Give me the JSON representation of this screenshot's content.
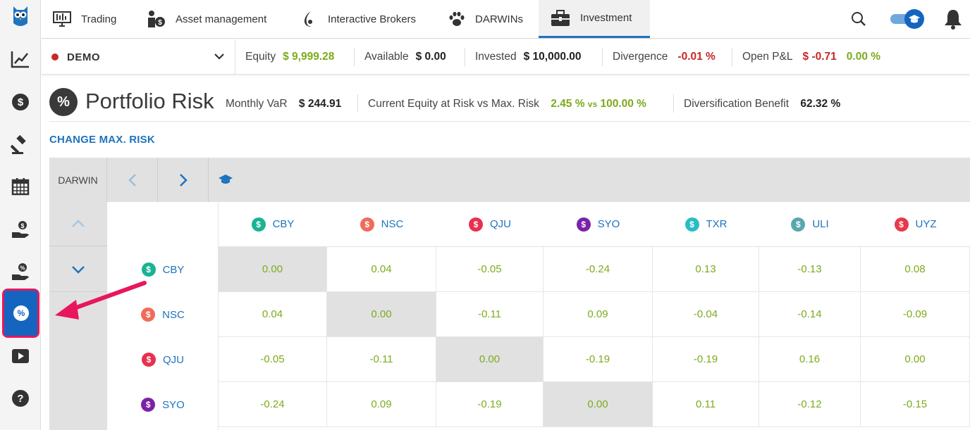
{
  "nav": {
    "items": [
      {
        "label": "Trading",
        "icon": "chart-monitor-icon"
      },
      {
        "label": "Asset management",
        "icon": "investor-icon"
      },
      {
        "label": "Interactive Brokers",
        "icon": "ib-logo-icon"
      },
      {
        "label": "DARWINs",
        "icon": "paw-icon"
      },
      {
        "label": "Investment",
        "icon": "briefcase-icon"
      }
    ],
    "active": "Investment"
  },
  "account": {
    "mode": "DEMO",
    "equity_label": "Equity",
    "equity": "$ 9,999.28",
    "available_label": "Available",
    "available": "$ 0.00",
    "invested_label": "Invested",
    "invested": "$ 10,000.00",
    "divergence_label": "Divergence",
    "divergence": "-0.01 %",
    "openpl_label": "Open P&L",
    "openpl": "$ -0.71",
    "openpl_pct": "0.00 %"
  },
  "risk": {
    "icon_glyph": "%",
    "title": "Portfolio Risk",
    "var_label": "Monthly VaR",
    "var": "$ 244.91",
    "equity_risk_label": "Current Equity at Risk vs Max. Risk",
    "equity_risk": "2.45 %",
    "vs": "vs",
    "max_risk": "100.00 %",
    "diversification_label": "Diversification Benefit",
    "diversification": "62.32 %",
    "change_link": "CHANGE MAX. RISK"
  },
  "table": {
    "corner_label": "DARWIN",
    "columns": [
      {
        "name": "CBY",
        "color": "#1ab394"
      },
      {
        "name": "NSC",
        "color": "#ef6c5b"
      },
      {
        "name": "QJU",
        "color": "#e8304f"
      },
      {
        "name": "SYO",
        "color": "#7b22a8"
      },
      {
        "name": "TXR",
        "color": "#28bcc6"
      },
      {
        "name": "ULI",
        "color": "#5aa7ad"
      },
      {
        "name": "UYZ",
        "color": "#e8394a"
      }
    ],
    "rows": [
      {
        "name": "CBY",
        "color": "#1ab394",
        "values": [
          "0.00",
          "0.04",
          "-0.05",
          "-0.24",
          "0.13",
          "-0.13",
          "0.08"
        ]
      },
      {
        "name": "NSC",
        "color": "#ef6c5b",
        "values": [
          "0.04",
          "0.00",
          "-0.11",
          "0.09",
          "-0.04",
          "-0.14",
          "-0.09"
        ]
      },
      {
        "name": "QJU",
        "color": "#e8304f",
        "values": [
          "-0.05",
          "-0.11",
          "0.00",
          "-0.19",
          "-0.19",
          "0.16",
          "0.00"
        ]
      },
      {
        "name": "SYO",
        "color": "#7b22a8",
        "values": [
          "-0.24",
          "0.09",
          "-0.19",
          "0.00",
          "0.11",
          "-0.12",
          "-0.15"
        ]
      }
    ],
    "badge_glyph": "$"
  },
  "colors": {
    "accent": "#1e73be",
    "positive": "#7cab1c",
    "negative": "#c62828",
    "highlight": "#e8175d"
  }
}
